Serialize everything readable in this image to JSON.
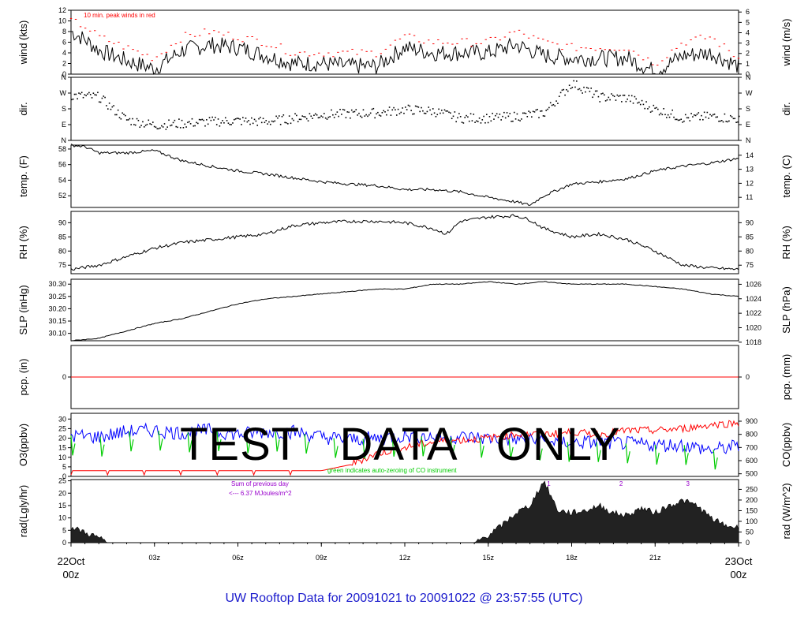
{
  "footer": {
    "prefix": "UW Rooftop Data for",
    "start": "20091021",
    "to": "to",
    "end": "20091022",
    "at": "@ 23:57:55",
    "tz": "(UTC)"
  },
  "watermark": "TEST   DATA   ONLY",
  "colors": {
    "red": "#ff0000",
    "blue": "#0000ff",
    "green": "#00cc00",
    "purple": "#9900cc",
    "black": "#000000"
  },
  "chart_data": [
    {
      "type": "line",
      "id": "wind",
      "ylabel_left": "wind (kts)",
      "ylabel_right": "wind (m/s)",
      "ylim": [
        0,
        12
      ],
      "yticks_left": [
        0,
        2,
        4,
        6,
        8,
        10,
        12
      ],
      "ylim_right": [
        0,
        6.17
      ],
      "yticks_right": [
        0,
        1,
        2,
        3,
        4,
        5,
        6
      ],
      "annotation": "10 min. peak winds in red",
      "x": [
        0,
        0.5,
        1,
        1.5,
        2,
        3,
        4,
        5,
        6,
        7,
        8,
        9,
        10,
        11,
        12,
        13,
        14,
        15,
        16,
        17,
        18,
        19,
        20,
        21,
        22,
        23,
        24
      ],
      "series": [
        {
          "values": [
            8,
            6.5,
            4.5,
            3.5,
            2.5,
            1,
            4.5,
            5.5,
            5,
            3.5,
            2,
            2,
            1.5,
            1.5,
            5,
            4,
            4,
            4,
            5.5,
            3.5,
            3,
            3,
            3,
            0.5,
            3.5,
            4,
            1.5
          ],
          "color": "black"
        },
        {
          "values": [
            10,
            9,
            7,
            6,
            5,
            3,
            7,
            8,
            7,
            6,
            4,
            4,
            4,
            4,
            7,
            6,
            6,
            6,
            8,
            6,
            5,
            5,
            5,
            2,
            6,
            7,
            3
          ],
          "color": "red",
          "marker": true
        }
      ]
    },
    {
      "type": "scatter",
      "id": "dir",
      "ylabel_left": "dir.",
      "ylabel_right": "dir.",
      "yticks_labels": [
        "N",
        "E",
        "S",
        "W",
        "N"
      ],
      "ylim": [
        0,
        360
      ],
      "x": [
        0,
        0.5,
        1,
        1.5,
        2,
        3,
        4,
        5,
        6,
        7,
        8,
        9,
        10,
        11,
        12,
        13,
        14,
        15,
        16,
        17,
        18,
        19,
        20,
        21,
        22,
        23,
        24
      ],
      "values": [
        260,
        255,
        250,
        180,
        120,
        90,
        100,
        110,
        115,
        110,
        130,
        150,
        155,
        160,
        180,
        170,
        130,
        130,
        140,
        160,
        330,
        250,
        245,
        180,
        130,
        140,
        125
      ]
    },
    {
      "type": "line",
      "id": "temp",
      "ylabel_left": "temp. (F)",
      "ylabel_right": "temp. (C)",
      "ylim": [
        50.5,
        58.5
      ],
      "yticks_left": [
        52,
        54,
        56,
        58
      ],
      "ylim_right": [
        10.28,
        14.72
      ],
      "yticks_right": [
        11,
        12,
        13,
        14
      ],
      "x": [
        0,
        0.5,
        1,
        2,
        3,
        4,
        5,
        6,
        7,
        8,
        9,
        10,
        11,
        12,
        13,
        14,
        15,
        16,
        16.5,
        17,
        18,
        19,
        20,
        21,
        22,
        23,
        24
      ],
      "values": [
        58.5,
        58.3,
        57.5,
        57.5,
        57.8,
        56.5,
        55.8,
        55.2,
        54.8,
        54.3,
        53.8,
        53.5,
        53.3,
        52.8,
        52.8,
        52.5,
        51.8,
        51.2,
        50.8,
        52,
        53.5,
        53.8,
        54.2,
        55.2,
        55.8,
        56.2,
        56.8
      ]
    },
    {
      "type": "line",
      "id": "rh",
      "ylabel_left": "RH (%)",
      "ylabel_right": "RH (%)",
      "ylim": [
        72,
        94
      ],
      "yticks_left": [
        75,
        80,
        85,
        90
      ],
      "yticks_right": [
        75,
        80,
        85,
        90
      ],
      "x": [
        0,
        1,
        2,
        3,
        4,
        5,
        6,
        7,
        8,
        9,
        10,
        11,
        12,
        13,
        13.5,
        14,
        15,
        16,
        16.5,
        17,
        18,
        19,
        20,
        21,
        22,
        23,
        24
      ],
      "values": [
        73.5,
        75,
        78,
        81,
        83,
        84,
        85,
        86,
        89,
        90,
        90.5,
        90.5,
        90,
        88,
        86,
        90.5,
        92,
        92.5,
        91,
        88,
        85,
        86,
        84,
        80,
        75,
        74,
        73.5
      ]
    },
    {
      "type": "line",
      "id": "slp",
      "ylabel_left": "SLP (inHg)",
      "ylabel_right": "SLP (hPa)",
      "ylim": [
        30.07,
        30.32
      ],
      "yticks_left": [
        30.1,
        30.15,
        30.2,
        30.25,
        30.3
      ],
      "ylim_right": [
        1018.2,
        1026.7
      ],
      "yticks_right": [
        1018,
        1020,
        1022,
        1024,
        1026
      ],
      "x": [
        0,
        1,
        2,
        3,
        4,
        5,
        6,
        7,
        8,
        9,
        10,
        11,
        12,
        13,
        14,
        15,
        16,
        17,
        18,
        19,
        20,
        21,
        22,
        23,
        24
      ],
      "values": [
        30.07,
        30.08,
        30.11,
        30.14,
        30.16,
        30.19,
        30.22,
        30.24,
        30.25,
        30.26,
        30.27,
        30.28,
        30.28,
        30.3,
        30.3,
        30.31,
        30.3,
        30.31,
        30.3,
        30.3,
        30.3,
        30.29,
        30.28,
        30.26,
        30.25
      ]
    },
    {
      "type": "line",
      "id": "pcp",
      "ylabel_left": "pcp. (in)",
      "ylabel_right": "pcp. (mm)",
      "ylim": [
        -1,
        1
      ],
      "yticks_left": [
        0
      ],
      "yticks_right": [
        0
      ],
      "x": [
        0,
        24
      ],
      "values": [
        0,
        0
      ],
      "color": "red"
    },
    {
      "type": "line",
      "id": "o3co",
      "ylabel_left": "O3(ppbv)",
      "ylabel_right": "CO(ppbv)",
      "ylim": [
        0,
        33
      ],
      "yticks_left": [
        0,
        5,
        10,
        15,
        20,
        25,
        30
      ],
      "ylim_right": [
        480,
        960
      ],
      "yticks_right": [
        500,
        600,
        700,
        800,
        900
      ],
      "annotation": "green indicates auto-zeroing of CO instrument",
      "x": [
        0,
        1,
        2,
        3,
        4,
        5,
        6,
        7,
        8,
        9,
        10,
        11,
        12,
        13,
        14,
        15,
        16,
        17,
        18,
        19,
        20,
        21,
        22,
        23,
        24
      ],
      "series": [
        {
          "name": "O3",
          "values": [
            3,
            3,
            3,
            3,
            3,
            3,
            3,
            3,
            3,
            3,
            6,
            12,
            15,
            18,
            19,
            20,
            22,
            22,
            23,
            22,
            24,
            24,
            25,
            27,
            28
          ],
          "color": "red"
        },
        {
          "name": "CO",
          "values": [
            790,
            780,
            820,
            830,
            810,
            830,
            800,
            820,
            820,
            780,
            760,
            770,
            790,
            780,
            780,
            770,
            760,
            750,
            740,
            740,
            730,
            720,
            720,
            680,
            710
          ],
          "color": "blue"
        }
      ]
    },
    {
      "type": "area",
      "id": "rad",
      "ylabel_left": "rad(Lgly/hr)",
      "ylabel_right": "rad (W/m^2)",
      "ylim": [
        0,
        25.5
      ],
      "yticks_left": [
        0,
        5,
        10,
        15,
        20,
        25
      ],
      "ylim_right": [
        0,
        296
      ],
      "yticks_right": [
        0,
        50,
        100,
        150,
        200,
        250
      ],
      "annotation": [
        "Sum of previous day",
        "<--- 6.37 MJoules/m^2"
      ],
      "peak_labels": [
        "1",
        "2",
        "3"
      ],
      "x": [
        0,
        0.3,
        1,
        1.3,
        14.5,
        15,
        15.5,
        16,
        16.5,
        17,
        17.5,
        18,
        18.5,
        19,
        19.5,
        20,
        20.5,
        21,
        21.5,
        22,
        22.5,
        23,
        23.5,
        24
      ],
      "values": [
        6,
        5,
        2,
        0,
        0,
        3,
        7,
        12,
        15,
        25,
        13,
        12,
        13,
        15,
        12,
        11,
        14,
        12,
        15,
        17,
        15,
        10,
        7,
        6
      ],
      "xtick_labels": [
        "22Oct\n00z",
        "03z",
        "06z",
        "09z",
        "12z",
        "15z",
        "18z",
        "21z",
        "23Oct\n00z"
      ]
    }
  ]
}
